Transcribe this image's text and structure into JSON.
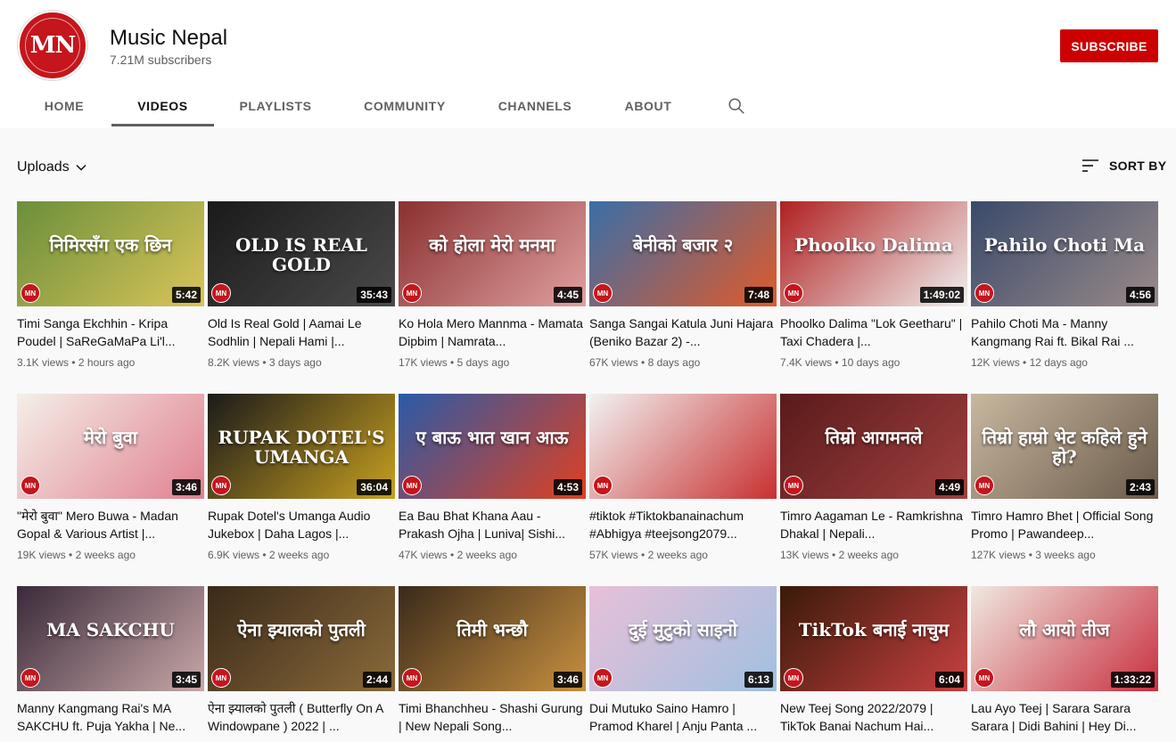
{
  "channel": {
    "name": "Music Nepal",
    "subscribers": "7.21M subscribers",
    "subscribe_label": "SUBSCRIBE",
    "avatar_text": "MN",
    "brand_color": "#c4161c"
  },
  "tabs": [
    {
      "label": "HOME",
      "active": false
    },
    {
      "label": "VIDEOS",
      "active": true
    },
    {
      "label": "PLAYLISTS",
      "active": false
    },
    {
      "label": "COMMUNITY",
      "active": false
    },
    {
      "label": "CHANNELS",
      "active": false
    },
    {
      "label": "ABOUT",
      "active": false
    }
  ],
  "search_icon": "search-icon",
  "uploads_label": "Uploads",
  "sort_label": "SORT BY",
  "videos": [
    {
      "title": "Timi Sanga Ekchhin - Kripa Poudel | SaReGaMaPa Li'l...",
      "views": "3.1K views",
      "age": "2 hours ago",
      "duration": "5:42",
      "thumb_text": "निमिरसँग एक छिन",
      "colors": [
        "#6b8f3a",
        "#d9c45a"
      ]
    },
    {
      "title": "Old Is Real Gold | Aamai Le Sodhlin | Nepali Hami |...",
      "views": "8.2K views",
      "age": "3 days ago",
      "duration": "35:43",
      "thumb_text": "OLD IS REAL GOLD",
      "colors": [
        "#1a1a1a",
        "#4a4a4a"
      ]
    },
    {
      "title": "Ko Hola Mero Mannma - Mamata Dipbim | Namrata...",
      "views": "17K views",
      "age": "5 days ago",
      "duration": "4:45",
      "thumb_text": "को होला मेरो मनमा",
      "colors": [
        "#8a3030",
        "#e0a0a0"
      ]
    },
    {
      "title": "Sanga Sangai Katula Juni Hajara (Beniko Bazar 2) -...",
      "views": "67K views",
      "age": "8 days ago",
      "duration": "7:48",
      "thumb_text": "बेनीको बजार २",
      "colors": [
        "#3a6ea8",
        "#e05a2a"
      ]
    },
    {
      "title": "Phoolko Dalima \"Lok Geetharu\" | Taxi Chadera |...",
      "views": "7.4K views",
      "age": "10 days ago",
      "duration": "1:49:02",
      "thumb_text": "Phoolko Dalima",
      "colors": [
        "#b02020",
        "#f0f0f0"
      ]
    },
    {
      "title": "Pahilo Choti Ma - Manny Kangmang Rai ft. Bikal Rai ...",
      "views": "12K views",
      "age": "12 days ago",
      "duration": "4:56",
      "thumb_text": "Pahilo Choti Ma",
      "colors": [
        "#3a4a6a",
        "#9a8a8a"
      ]
    },
    {
      "title": "\"मेरो बुवा\" Mero Buwa - Madan Gopal & Various Artist |...",
      "views": "19K views",
      "age": "2 weeks ago",
      "duration": "3:46",
      "thumb_text": "मेरो बुवा",
      "colors": [
        "#f4efe8",
        "#e08090"
      ]
    },
    {
      "title": "Rupak Dotel's Umanga Audio Jukebox | Daha Lagos |...",
      "views": "6.9K views",
      "age": "2 weeks ago",
      "duration": "36:04",
      "thumb_text": "RUPAK DOTEL'S UMANGA",
      "colors": [
        "#1a1a1a",
        "#c8a020"
      ]
    },
    {
      "title": "Ea Bau Bhat Khana Aau - Prakash Ojha | Luniva| Sishi...",
      "views": "47K views",
      "age": "2 weeks ago",
      "duration": "4:53",
      "thumb_text": "ए बाऊ भात खान आऊ",
      "colors": [
        "#2a5aa8",
        "#e04020"
      ]
    },
    {
      "title": "#tiktok #Tiktokbanainachum #Abhigya #teejsong2079...",
      "views": "57K views",
      "age": "2 weeks ago",
      "duration": "",
      "thumb_text": "",
      "colors": [
        "#f2f2f2",
        "#c83030"
      ]
    },
    {
      "title": "Timro Aagaman Le - Ramkrishna Dhakal | Nepali...",
      "views": "13K views",
      "age": "2 weeks ago",
      "duration": "4:49",
      "thumb_text": "तिम्रो आगमनले",
      "colors": [
        "#5a1a1a",
        "#a04040"
      ]
    },
    {
      "title": "Timro Hamro Bhet | Official Song Promo | Pawandeep...",
      "views": "127K views",
      "age": "3 weeks ago",
      "duration": "2:43",
      "thumb_text": "तिम्रो हाम्रो भेट कहिले हुने हो?",
      "colors": [
        "#c8b8a0",
        "#6a5a4a"
      ]
    },
    {
      "title": "Manny Kangmang Rai's MA SAKCHU ft. Puja Yakha | Ne...",
      "views": "",
      "age": "",
      "duration": "3:45",
      "thumb_text": "MA SAKCHU",
      "colors": [
        "#3a2a3a",
        "#c8a8a8"
      ]
    },
    {
      "title": "ऐना झ्यालको पुतली ( Butterfly On A Windowpane ) 2022 | ...",
      "views": "",
      "age": "",
      "duration": "2:44",
      "thumb_text": "ऐना झ्यालको पुतली",
      "colors": [
        "#3a2a1a",
        "#8a6a3a"
      ]
    },
    {
      "title": "Timi Bhanchheu - Shashi Gurung | New Nepali Song...",
      "views": "",
      "age": "",
      "duration": "3:46",
      "thumb_text": "तिमी भन्छौ",
      "colors": [
        "#3a2a1a",
        "#c89040"
      ]
    },
    {
      "title": "Dui Mutuko Saino Hamro | Pramod Kharel | Anju Panta ...",
      "views": "",
      "age": "",
      "duration": "6:13",
      "thumb_text": "दुई मुटुको साइनो",
      "colors": [
        "#e8c0d8",
        "#a0c0e0"
      ]
    },
    {
      "title": "New Teej Song 2022/2079 | TikTok Banai Nachum Hai...",
      "views": "",
      "age": "",
      "duration": "6:04",
      "thumb_text": "TikTok बनाई नाचुम",
      "colors": [
        "#3a1a0a",
        "#c84040"
      ]
    },
    {
      "title": "Lau Ayo Teej | Sarara Sarara Sarara | Didi Bahini | Hey Di...",
      "views": "",
      "age": "",
      "duration": "1:33:22",
      "thumb_text": "लौ आयो तीज",
      "colors": [
        "#f0e8e0",
        "#c83040"
      ]
    }
  ]
}
